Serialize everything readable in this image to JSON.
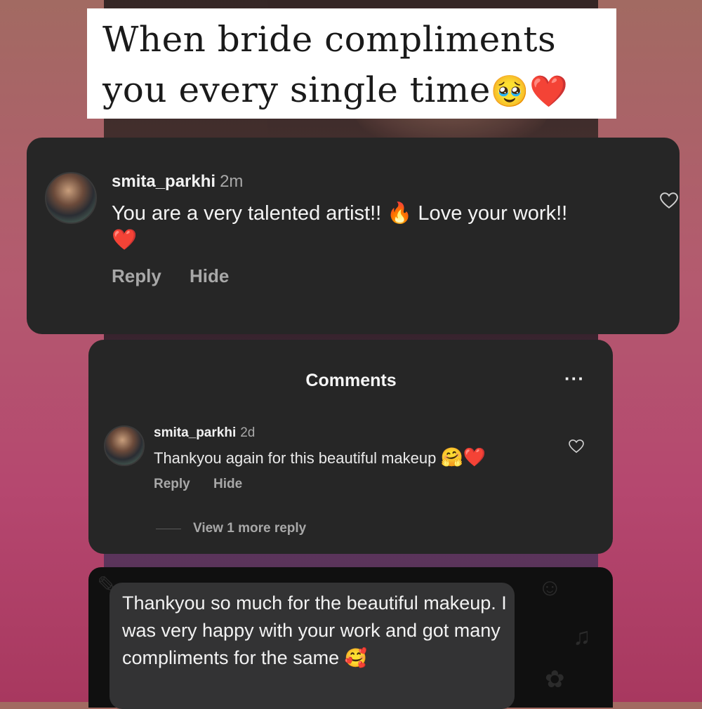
{
  "caption": {
    "line1": "When bride compliments",
    "line2": "you every single time",
    "emoji": "🥹❤️"
  },
  "comment_top": {
    "username": "smita_parkhi",
    "time": "2m",
    "text_part1": "You are a very talented artist!! ",
    "fire_emoji": "🔥",
    "text_part2": " Love your work!!",
    "heart_emoji": "❤️",
    "reply_label": "Reply",
    "hide_label": "Hide",
    "like_icon": "heart-outline-icon"
  },
  "comments_panel": {
    "title": "Comments",
    "more_label": "···",
    "comment": {
      "username": "smita_parkhi",
      "time": "2d",
      "text": "Thankyou again for this beautiful makeup ",
      "emojis": "🤗❤️",
      "reply_label": "Reply",
      "hide_label": "Hide"
    },
    "view_more_label": "View 1 more reply"
  },
  "message": {
    "text": "Thankyou so much for the beautiful makeup. I was very happy with your work and got many compliments for the same ",
    "emoji": "🥰"
  },
  "colors": {
    "card_bg": "#262626",
    "muted_text": "#a8a8a8",
    "background_pink": "#b5476f"
  }
}
